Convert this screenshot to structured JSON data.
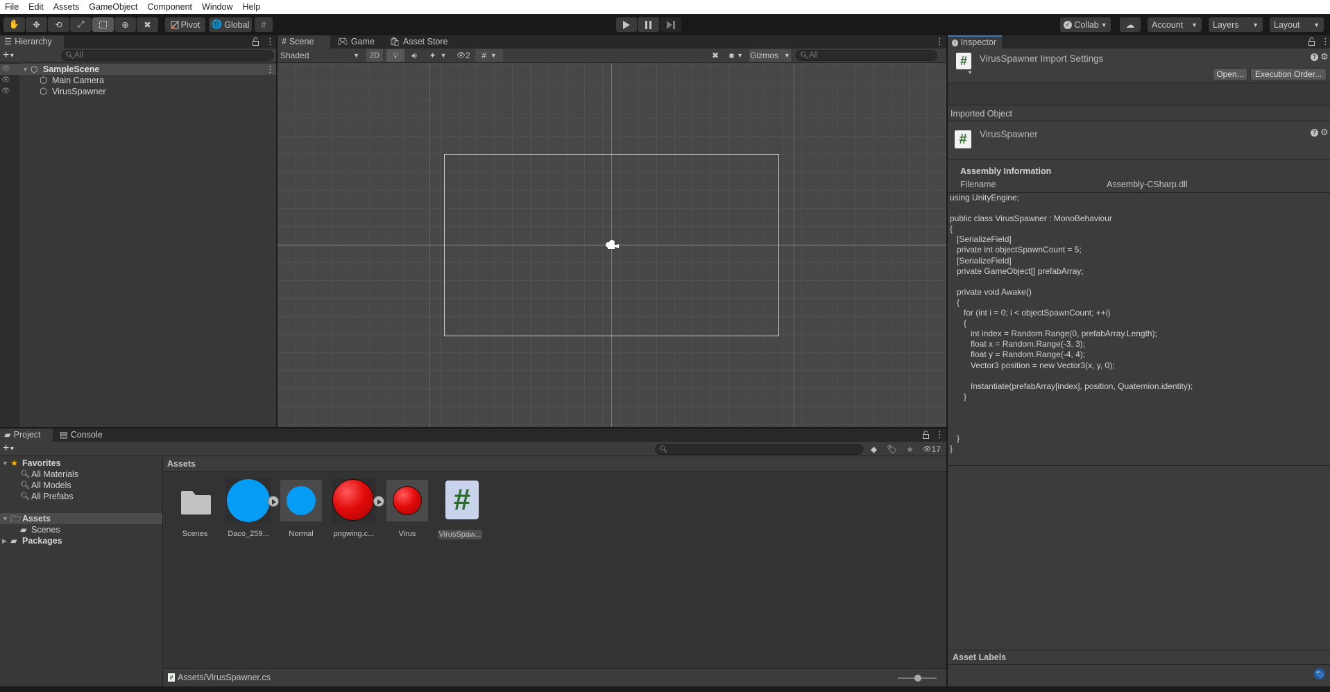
{
  "menu": [
    "File",
    "Edit",
    "Assets",
    "GameObject",
    "Component",
    "Window",
    "Help"
  ],
  "toolbar": {
    "tools": [
      "hand-tool",
      "move-tool",
      "rotate-tool",
      "scale-tool",
      "rect-tool",
      "transform-tool",
      "custom-tool"
    ],
    "active_tool": "rect-tool",
    "pivot_label": "Pivot",
    "global_label": "Global",
    "collab_label": "Collab",
    "account_label": "Account",
    "layers_label": "Layers",
    "layout_label": "Layout"
  },
  "hierarchy": {
    "tab_label": "Hierarchy",
    "search_placeholder": "All",
    "scene_name": "SampleScene",
    "items": [
      "Main Camera",
      "VirusSpawner"
    ]
  },
  "scene": {
    "tabs": [
      "Scene",
      "Game",
      "Asset Store"
    ],
    "active_tab": "Scene",
    "shading_mode": "Shaded",
    "mode_2d_label": "2D",
    "hidden_count": "2",
    "gizmos_label": "Gizmos",
    "search_placeholder": "All"
  },
  "inspector": {
    "tab_label": "Inspector",
    "title": "VirusSpawner Import Settings",
    "open_button": "Open...",
    "execution_order_button": "Execution Order...",
    "imported_object_label": "Imported Object",
    "object_name": "VirusSpawner",
    "assembly_header": "Assembly Information",
    "filename_label": "Filename",
    "filename_value": "Assembly-CSharp.dll",
    "code": "using UnityEngine;\n\npublic class VirusSpawner : MonoBehaviour\n{\n   [SerializeField]\n   private int objectSpawnCount = 5;\n   [SerializeField]\n   private GameObject[] prefabArray;\n\n   private void Awake()\n   {\n      for (int i = 0; i < objectSpawnCount; ++i)\n      {\n         int index = Random.Range(0, prefabArray.Length);\n         float x = Random.Range(-3, 3);\n         float y = Random.Range(-4, 4);\n         Vector3 position = new Vector3(x, y, 0);\n\n         Instantiate(prefabArray[index], position, Quaternion.identity);\n      }\n\n\n\n   }\n}",
    "asset_labels_label": "Asset Labels"
  },
  "project": {
    "tabs": [
      "Project",
      "Console"
    ],
    "active_tab": "Project",
    "hidden_count": "17",
    "tree": {
      "favorites_label": "Favorites",
      "favorites": [
        "All Materials",
        "All Models",
        "All Prefabs"
      ],
      "assets_label": "Assets",
      "assets_children": [
        "Scenes"
      ],
      "packages_label": "Packages"
    },
    "breadcrumb": "Assets",
    "assets": [
      {
        "name": "Scenes",
        "type": "folder"
      },
      {
        "name": "Daco_259...",
        "type": "sprite-blue-large"
      },
      {
        "name": "Normal",
        "type": "prefab-blue"
      },
      {
        "name": "pngwing.c...",
        "type": "sprite-red-large"
      },
      {
        "name": "Virus",
        "type": "prefab-red"
      },
      {
        "name": "VirusSpaw...",
        "type": "script",
        "selected": true
      }
    ],
    "status_path": "Assets/VirusSpawner.cs",
    "thumbnail_size": 0.55
  },
  "colors": {
    "accent_tab": "#3a79bb",
    "script_hash": "#2e6b2e",
    "blue_sprite": "#049cf5",
    "red_sprite": "#e20c0c"
  }
}
